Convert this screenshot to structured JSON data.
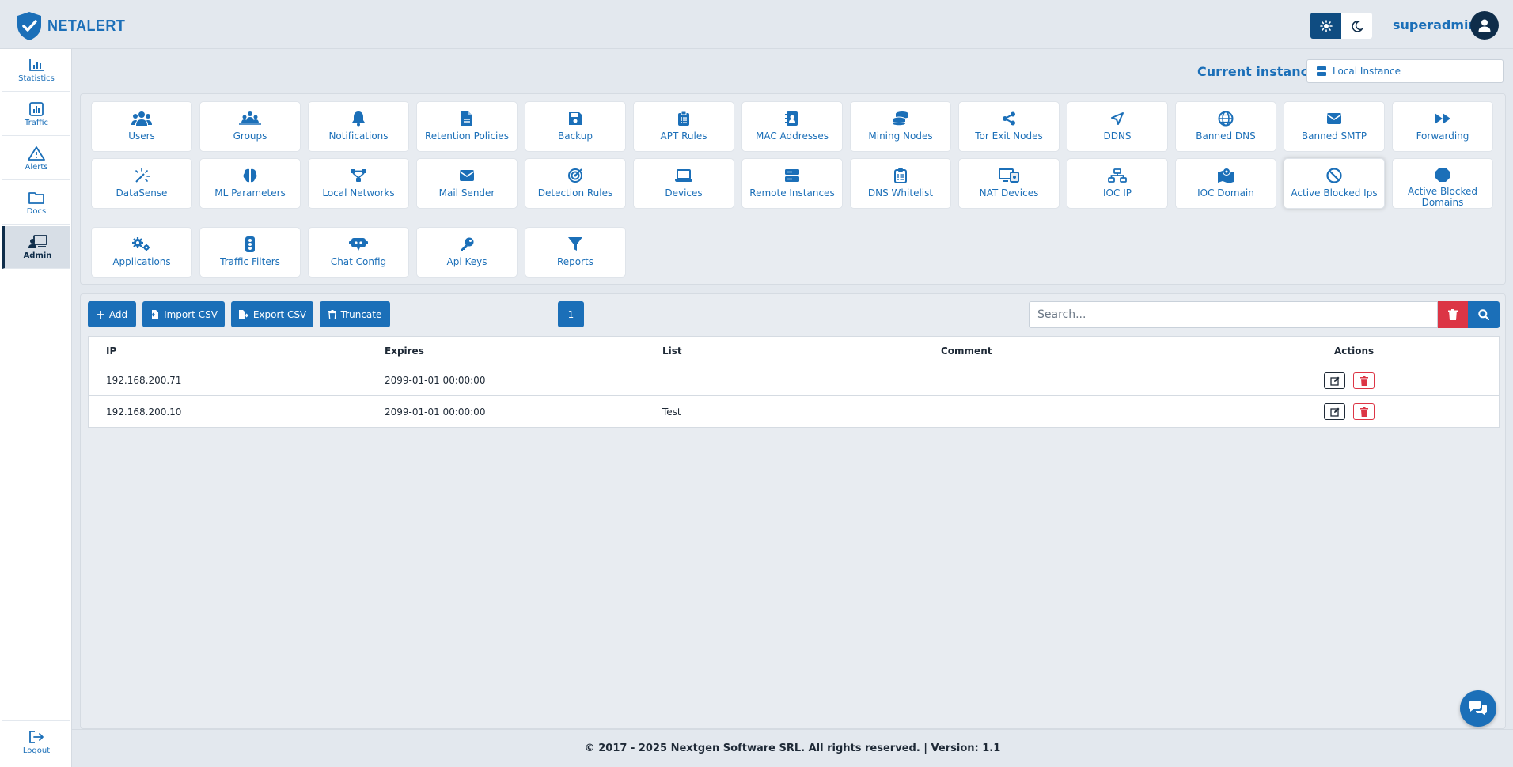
{
  "app": {
    "brand": "NETALERT"
  },
  "header": {
    "username": "superadmin"
  },
  "sidebar": {
    "items": [
      {
        "label": "Statistics",
        "icon": "chart-bar-icon"
      },
      {
        "label": "Traffic",
        "icon": "chart-square-icon"
      },
      {
        "label": "Alerts",
        "icon": "warning-icon"
      },
      {
        "label": "Docs",
        "icon": "folder-icon"
      },
      {
        "label": "Admin",
        "icon": "admin-icon",
        "active": true
      }
    ],
    "logout": "Logout"
  },
  "instance": {
    "label": "Current instance:",
    "value": "Local Instance"
  },
  "tiles": [
    "Users",
    "Groups",
    "Notifications",
    "Retention Policies",
    "Backup",
    "APT Rules",
    "MAC Addresses",
    "Mining Nodes",
    "Tor Exit Nodes",
    "DDNS",
    "Banned DNS",
    "Banned SMTP",
    "Forwarding",
    "DataSense",
    "ML Parameters",
    "Local Networks",
    "Mail Sender",
    "Detection Rules",
    "Devices",
    "Remote Instances",
    "DNS Whitelist",
    "NAT Devices",
    "IOC IP",
    "IOC Domain",
    "Active Blocked Ips",
    "Active Blocked Domains",
    "Applications",
    "Traffic Filters",
    "Chat Config",
    "Api Keys",
    "Reports"
  ],
  "toolbar": {
    "add": "Add",
    "import_csv": "Import CSV",
    "export_csv": "Export CSV",
    "truncate": "Truncate",
    "page": "1",
    "search_placeholder": "Search..."
  },
  "table": {
    "columns": [
      "IP",
      "Expires",
      "List",
      "Comment",
      "Actions"
    ],
    "rows": [
      {
        "ip": "192.168.200.71",
        "expires": "2099-01-01 00:00:00",
        "list": "",
        "comment": ""
      },
      {
        "ip": "192.168.200.10",
        "expires": "2099-01-01 00:00:00",
        "list": "Test",
        "comment": ""
      }
    ]
  },
  "footer": {
    "text": "© 2017 - 2025 Nextgen Software SRL. All rights reserved. | Version: 1.1"
  },
  "colors": {
    "accent": "#1b6fb8",
    "navy": "#0f2d4a",
    "danger": "#dc3545",
    "background": "#e3e8ee"
  }
}
